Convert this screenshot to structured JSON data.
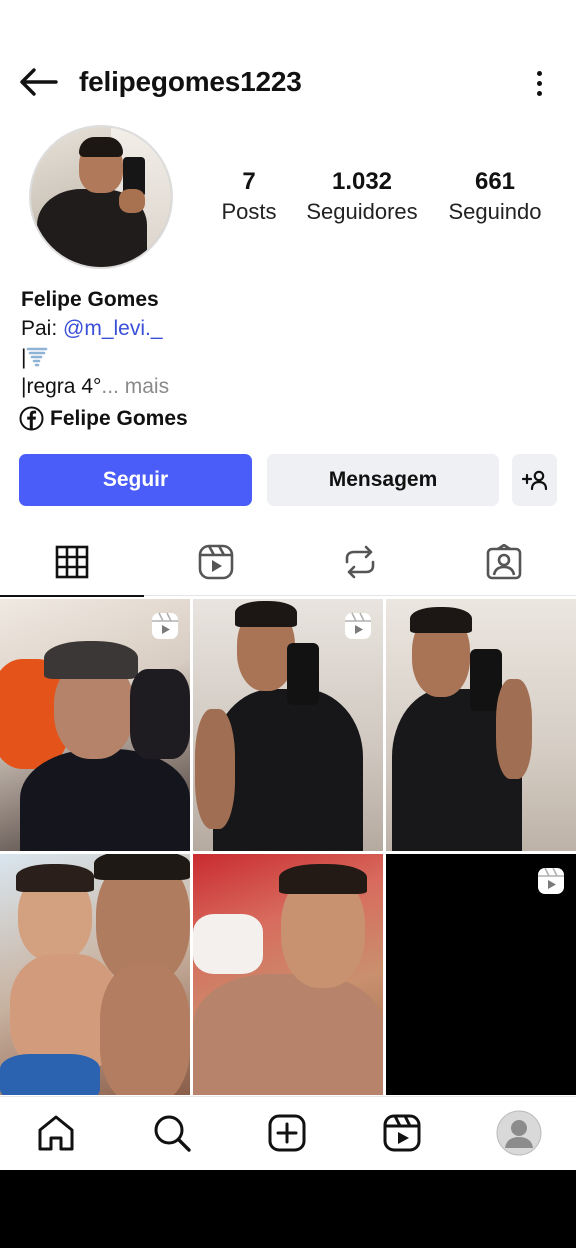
{
  "header": {
    "username": "felipegomes1223"
  },
  "stats": {
    "posts_count": "7",
    "posts_label": "Posts",
    "followers_count": "1.032",
    "followers_label": "Seguidores",
    "following_count": "661",
    "following_label": "Seguindo"
  },
  "bio": {
    "name": "Felipe Gomes",
    "line1_prefix": "Pai: ",
    "line1_mention": "@m_levi._",
    "line2_prefix": "|",
    "line3_text": "|regra 4°",
    "line3_more": "... mais",
    "facebook_name": "Felipe Gomes"
  },
  "buttons": {
    "follow": "Seguir",
    "message": "Mensagem"
  },
  "tabs": [
    "grid-icon",
    "reels-icon",
    "reposts-icon",
    "tagged-icon"
  ],
  "grid": {
    "posts": [
      {
        "type": "reel"
      },
      {
        "type": "reel"
      },
      {
        "type": "photo"
      },
      {
        "type": "photo"
      },
      {
        "type": "photo"
      },
      {
        "type": "reel"
      }
    ]
  },
  "nav": [
    "home-icon",
    "search-icon",
    "create-icon",
    "reels-icon",
    "profile-avatar"
  ],
  "colors": {
    "accent": "#4a5df9",
    "mention": "#3a4fd8",
    "secondary_button": "#eff0f4"
  }
}
